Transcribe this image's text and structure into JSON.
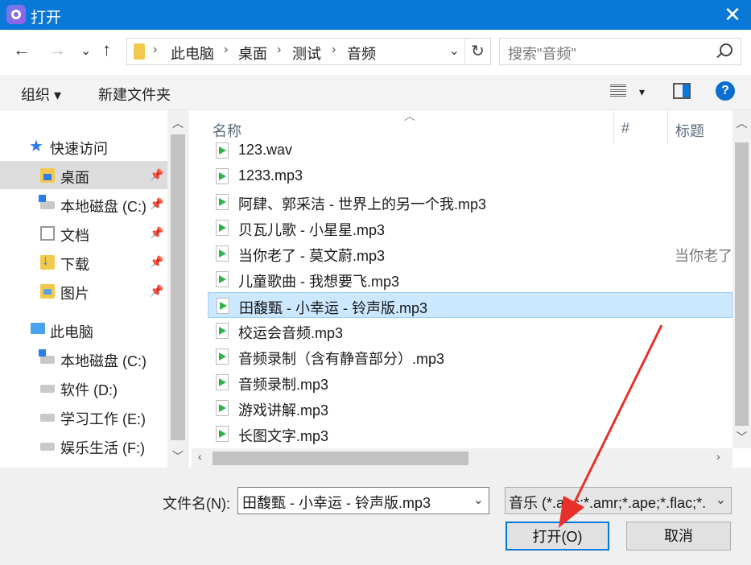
{
  "window": {
    "title": "打开",
    "close_glyph": "✕"
  },
  "nav": {
    "back": "←",
    "forward": "→",
    "recent": "⌄",
    "up": "↑",
    "breadcrumb": [
      "此电脑",
      "桌面",
      "测试",
      "音频"
    ],
    "sep": "›",
    "dropdown": "⌄",
    "refresh": "↻",
    "search_placeholder": "搜索\"音频\""
  },
  "toolbar": {
    "organize": "组织 ▾",
    "new_folder": "新建文件夹",
    "view_dd": "▾",
    "help": "?"
  },
  "sidebar": {
    "quick_access": "快速访问",
    "items": [
      {
        "label": "桌面",
        "pinned": true
      },
      {
        "label": "本地磁盘 (C:)",
        "pinned": true
      },
      {
        "label": "文档",
        "pinned": true
      },
      {
        "label": "下载",
        "pinned": true
      },
      {
        "label": "图片",
        "pinned": true
      }
    ],
    "this_pc": "此电脑",
    "drives": [
      "本地磁盘 (C:)",
      "软件 (D:)",
      "学习工作 (E:)",
      "娱乐生活 (F:)"
    ],
    "pin_glyph": "📌"
  },
  "columns": {
    "name": "名称",
    "number": "#",
    "title": "标题",
    "sort_glyph": "︿"
  },
  "files": [
    {
      "name": "123.wav",
      "title": ""
    },
    {
      "name": "1233.mp3",
      "title": ""
    },
    {
      "name": "阿肆、郭采洁 - 世界上的另一个我.mp3",
      "title": ""
    },
    {
      "name": "贝瓦儿歌 - 小星星.mp3",
      "title": ""
    },
    {
      "name": "当你老了 - 莫文蔚.mp3",
      "title": "当你老了"
    },
    {
      "name": "儿童歌曲 - 我想要飞.mp3",
      "title": ""
    },
    {
      "name": "田馥甄 - 小幸运 - 铃声版.mp3",
      "title": "",
      "selected": true
    },
    {
      "name": "校运会音频.mp3",
      "title": ""
    },
    {
      "name": "音频录制（含有静音部分）.mp3",
      "title": ""
    },
    {
      "name": "音频录制.mp3",
      "title": ""
    },
    {
      "name": "游戏讲解.mp3",
      "title": ""
    },
    {
      "name": "长图文字.mp3",
      "title": ""
    }
  ],
  "scroll": {
    "up": "︿",
    "down": "﹀",
    "left": "‹",
    "right": "›"
  },
  "footer": {
    "filename_label": "文件名(N):",
    "filename_value": "田馥甄 - 小幸运 - 铃声版.mp3",
    "filter_value": "音乐 (*.aac;*.amr;*.ape;*.flac;*.",
    "dd": "⌄",
    "open_button": "打开(O)",
    "cancel_button": "取消"
  },
  "colors": {
    "accent": "#0a78d7",
    "selected_row": "#cce8ff",
    "annotation_arrow": "#e8302a"
  }
}
